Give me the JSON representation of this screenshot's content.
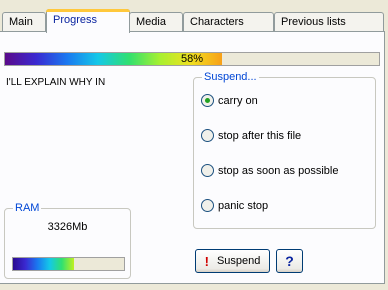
{
  "tabs": [
    {
      "label": "Main",
      "active": false
    },
    {
      "label": "Progress",
      "active": true
    },
    {
      "label": "Media",
      "active": false
    },
    {
      "label": "Characters",
      "active": false
    },
    {
      "label": "Previous lists",
      "active": false
    }
  ],
  "progress": {
    "percent_label": "58%",
    "fraction": 0.58
  },
  "status_message": "I'LL EXPLAIN WHY IN",
  "suspend": {
    "legend": "Suspend...",
    "options": [
      {
        "label": "carry on",
        "checked": true
      },
      {
        "label": "stop after this file",
        "checked": false
      },
      {
        "label": "stop as soon as possible",
        "checked": false
      },
      {
        "label": "panic stop",
        "checked": false
      }
    ]
  },
  "ram": {
    "legend": "RAM",
    "value": "3326Mb",
    "fraction": 0.55
  },
  "buttons": {
    "suspend_icon": "!",
    "suspend_label": "Suspend",
    "help_label": "?"
  },
  "colors": {
    "accent_legend": "#0046d5",
    "active_tab_highlight": "#ffc83c",
    "panel_bg": "#fcfcfe"
  }
}
